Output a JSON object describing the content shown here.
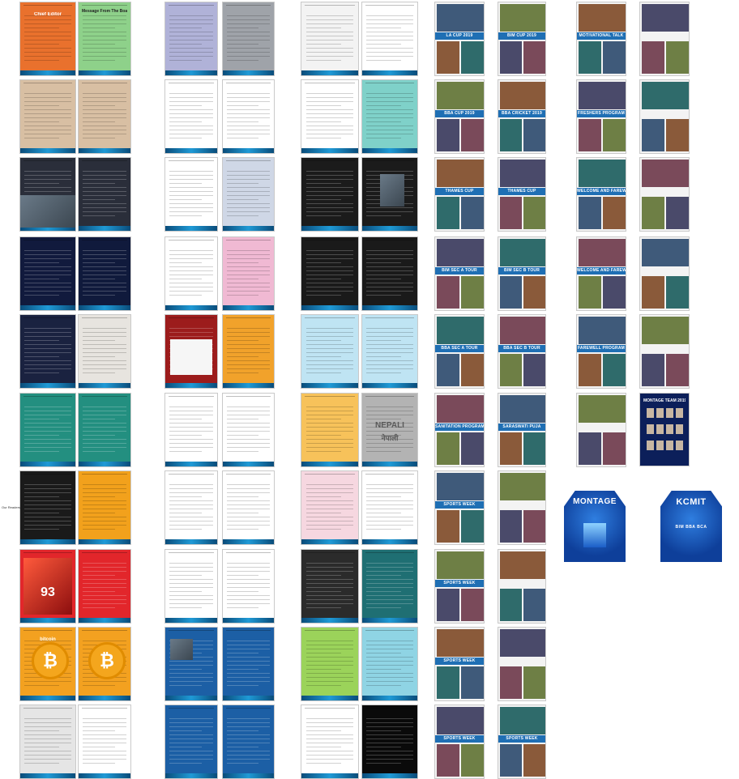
{
  "labels": {
    "chief_editor": "Chief Editor",
    "msg_board": "Message From The Board Member",
    "bitcoin": "bitcoin",
    "nepali_en": "NEPALI",
    "nepali_dev": "नेपाली",
    "montage": "MONTAGE",
    "kcmit": "KCMIT",
    "programs": "BIM BBA BCA",
    "montage_team": "MONTAGE TEAM 2019",
    "side_label": "Our Readers",
    "race_number": "93"
  },
  "col5_titles": [
    "LA CUP 2019",
    "BBA CUP 2019",
    "THAMES CUP",
    "BIM SEC A TOUR",
    "BBA SEC A TOUR",
    "SANITATION PROGRAM",
    "SPORTS WEEK",
    "SPORTS WEEK",
    "SPORTS WEEK",
    "SPORTS WEEK"
  ],
  "col6_titles": [
    "BIM CUP 2019",
    "BBA CRICKET 2019",
    "THAMES CUP",
    "BIM SEC B TOUR",
    "BBA SEC B TOUR",
    "SARASWATI PUJA",
    "",
    "",
    "",
    "SPORTS WEEK"
  ],
  "col7_titles": [
    "MOTIVATIONAL TALK",
    "FRESHERS PROGRAM",
    "WELCOME AND FAREWELL",
    "WELCOME AND FAREWELL",
    "FAREWELL PROGRAM",
    ""
  ],
  "colors": {
    "accent_blue": "#1f86c8",
    "strip_blue": "#1f6fb4",
    "cover_blue": "#0e3f9a"
  }
}
